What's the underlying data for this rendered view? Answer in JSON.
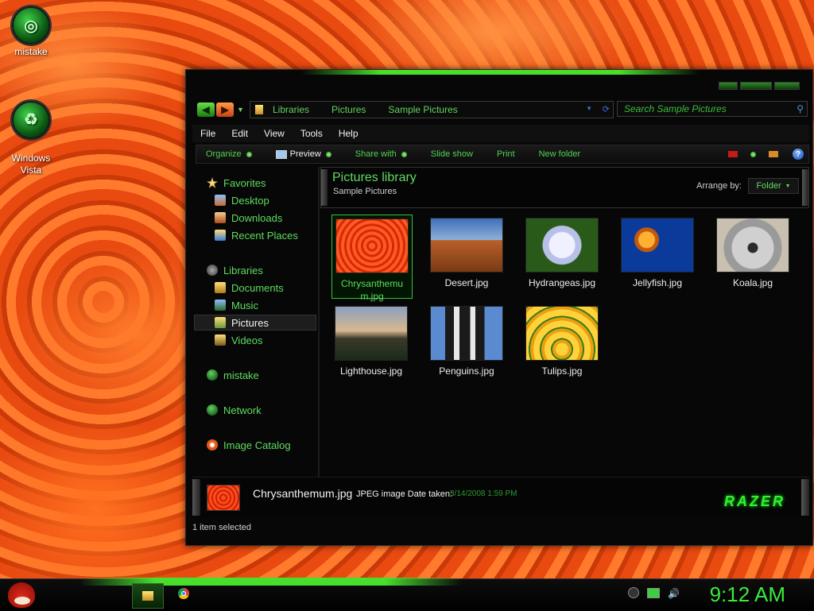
{
  "desktop": {
    "icons": [
      {
        "label": "mistake",
        "icon": "recycle-bin-empty-icon"
      },
      {
        "label": "Windows\nVista",
        "icon": "recycle-bin-icon"
      }
    ]
  },
  "window": {
    "nav": {
      "breadcrumb": [
        "Libraries",
        "Pictures",
        "Sample Pictures"
      ],
      "search_placeholder": "Search Sample Pictures"
    },
    "menu": [
      "File",
      "Edit",
      "View",
      "Tools",
      "Help"
    ],
    "commands": {
      "organize": "Organize",
      "preview": "Preview",
      "share_with": "Share with",
      "slide_show": "Slide show",
      "print": "Print",
      "new_folder": "New folder"
    },
    "sidebar": {
      "favorites_header": "Favorites",
      "favorites": [
        "Desktop",
        "Downloads",
        "Recent Places"
      ],
      "libraries_header": "Libraries",
      "libraries": [
        "Documents",
        "Music",
        "Pictures",
        "Videos"
      ],
      "homegroup": "mistake",
      "network": "Network",
      "image_catalog": "Image Catalog",
      "selected": "Pictures"
    },
    "library": {
      "title": "Pictures library",
      "subtitle": "Sample Pictures",
      "arrange_label": "Arrange by:",
      "arrange_value": "Folder"
    },
    "files": [
      {
        "name": "Chrysanthemum.jpg",
        "line1": "Chrysanthemu",
        "line2": "m.jpg",
        "selected": true
      },
      {
        "name": "Desert.jpg"
      },
      {
        "name": "Hydrangeas.jpg"
      },
      {
        "name": "Jellyfish.jpg"
      },
      {
        "name": "Koala.jpg"
      },
      {
        "name": "Lighthouse.jpg"
      },
      {
        "name": "Penguins.jpg"
      },
      {
        "name": "Tulips.jpg"
      }
    ],
    "details": {
      "name": "Chrysanthemum.jpg",
      "type": "JPEG image Date taken:",
      "date": "3/14/2008 1:59 PM",
      "brand": "RAZER"
    },
    "status": "1 item selected"
  },
  "taskbar": {
    "clock": "9:12 AM",
    "accent": "#46e02c"
  }
}
